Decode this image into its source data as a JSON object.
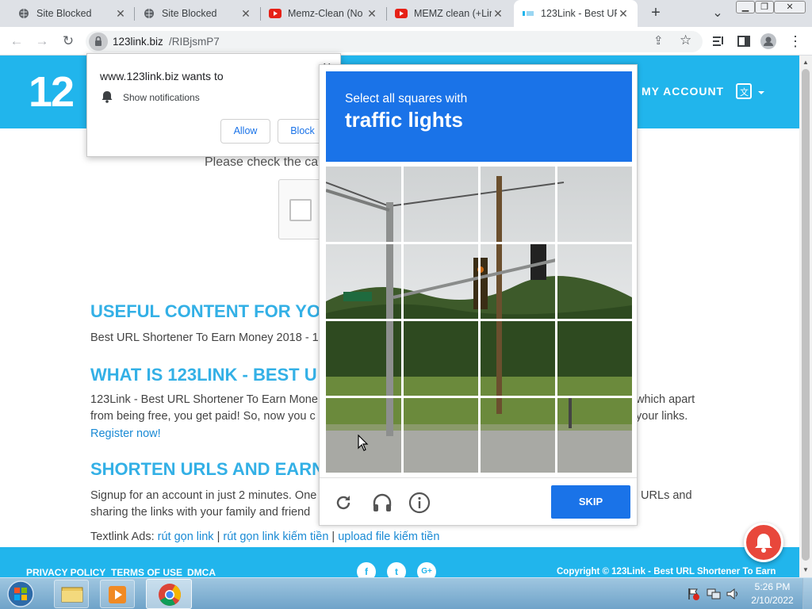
{
  "browser": {
    "tabs": [
      {
        "title": "Site Blocked",
        "icon": "globe-icon"
      },
      {
        "title": "Site Blocked",
        "icon": "globe-icon"
      },
      {
        "title": "Memz-Clean (No",
        "icon": "youtube-icon"
      },
      {
        "title": "MEMZ clean (+Lin",
        "icon": "youtube-icon"
      },
      {
        "title": "123Link - Best UR",
        "icon": "site-favicon"
      }
    ],
    "new_tab": "+",
    "tab_menu": "⌄",
    "url_domain": "123link.biz",
    "url_path": "/RIBjsmP7"
  },
  "notification": {
    "title": "www.123link.biz wants to",
    "item": "Show notifications",
    "allow": "Allow",
    "block": "Block",
    "close": "×"
  },
  "site": {
    "logo": "12",
    "account": "MY ACCOUNT",
    "check_text": "Please check the ca",
    "sections": [
      {
        "heading": "USEFUL CONTENT FOR YO",
        "lines": [
          "Best URL Shortener To Earn Money 2018 - 1"
        ]
      },
      {
        "heading": "WHAT IS 123LINK - BEST U",
        "lines": [
          "123Link - Best URL Shortener To Earn Mone",
          "from being free, you get paid! So, now you c"
        ],
        "right": [
          "which apart",
          "your links."
        ],
        "link": "Register now!"
      },
      {
        "heading": "SHORTEN URLS AND EARN",
        "lines": [
          "Signup for an account in just 2 minutes. One",
          "sharing the links with your family and friend"
        ],
        "right": [
          "t URLs and"
        ]
      }
    ],
    "textlink_label": "Textlink Ads:",
    "textlinks": [
      "rút gọn link",
      "rút gọn link kiếm tiền",
      "upload file kiếm tiền"
    ],
    "sep": "|",
    "footer_links": [
      "PRIVACY POLICY",
      "TERMS OF USE",
      "DMCA"
    ],
    "social": [
      "f",
      "t",
      "G+"
    ],
    "copyright": "Copyright © 123Link - Best URL Shortener To Earn"
  },
  "captcha": {
    "instruction": "Select all squares with",
    "target": "traffic lights",
    "skip": "SKIP",
    "tools": [
      "reload-icon",
      "audio-icon",
      "info-icon"
    ]
  },
  "taskbar": {
    "time": "5:26 PM",
    "date": "2/10/2022",
    "apps": [
      "start-orb",
      "file-explorer-icon",
      "media-player-icon",
      "chrome-icon"
    ]
  },
  "colors": {
    "brand": "#21b5ec",
    "recaptcha_blue": "#1a73e8",
    "heading": "#33b0e6"
  }
}
